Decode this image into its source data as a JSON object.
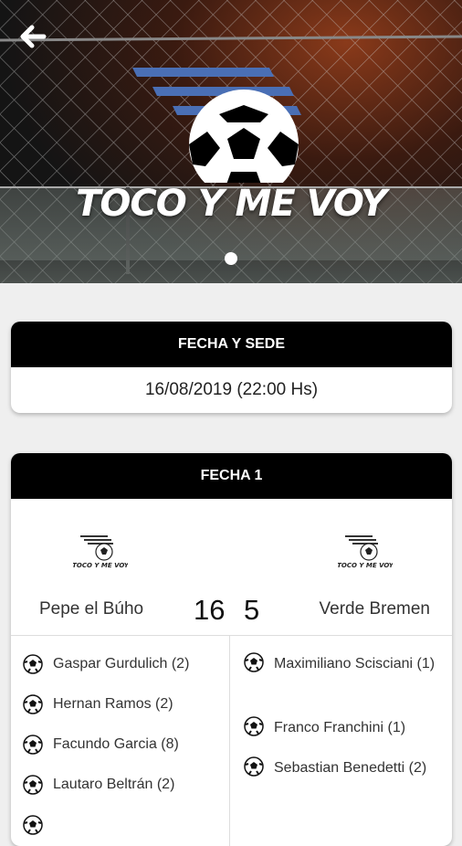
{
  "header": {
    "brand_title": "TOCO Y ME VOY",
    "logo_caption": "TOCO Y ME VOY",
    "back_icon": "arrow-left-icon",
    "carousel": {
      "count": 1,
      "active": 1
    }
  },
  "venue_card": {
    "title": "FECHA Y SEDE",
    "datetime": "16/08/2019 (22:00 Hs)"
  },
  "match_card": {
    "title": "FECHA 1",
    "home": {
      "name": "Pepe el Búho",
      "score": "16"
    },
    "away": {
      "name": "Verde Bremen",
      "score": "5"
    },
    "home_scorers": [
      "Gaspar Gurdulich (2)",
      "Hernan Ramos (2)",
      "Facundo Garcia (8)",
      "Lautaro Beltrán (2)"
    ],
    "away_scorers": [
      "Maximiliano Scisciani (1)",
      "Franco Franchini (1)",
      "Sebastian Benedetti (2)"
    ]
  },
  "colors": {
    "accent_blue": "#4a6fb5",
    "header_black": "#000000"
  }
}
